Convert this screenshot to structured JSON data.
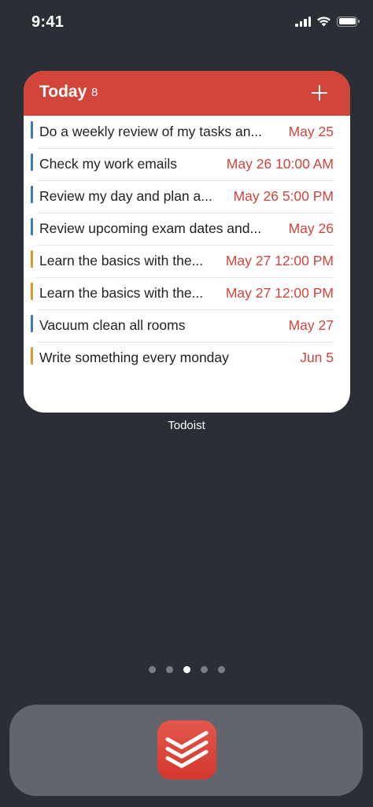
{
  "status_bar": {
    "time": "9:41",
    "signal_icon": "cellular-signal-icon",
    "wifi_icon": "wifi-icon",
    "battery_icon": "battery-icon"
  },
  "widget": {
    "title": "Today",
    "count": "8",
    "add_icon": "plus-icon",
    "accent_color": "#d1453b",
    "tasks": [
      {
        "title": "Do a weekly review of my tasks an...",
        "date": "May 25",
        "color": "#3d7ac9"
      },
      {
        "title": "Check my work emails",
        "date": "May 26 10:00 AM",
        "color": "#3d7ac9"
      },
      {
        "title": "Review my day and plan a...",
        "date": "May 26 5:00 PM",
        "color": "#3d7ac9"
      },
      {
        "title": "Review upcoming exam dates and...",
        "date": "May 26",
        "color": "#3d7ac9"
      },
      {
        "title": "Learn the basics with the...",
        "date": "May 27 12:00 PM",
        "color": "#e0982d"
      },
      {
        "title": "Learn the basics with the...",
        "date": "May 27 12:00 PM",
        "color": "#e0982d"
      },
      {
        "title": "Vacuum clean all rooms",
        "date": "May 27",
        "color": "#3d7ac9"
      },
      {
        "title": "Write something every monday",
        "date": "Jun 5",
        "color": "#e0982d"
      }
    ]
  },
  "widget_label": "Todoist",
  "page_indicator": {
    "pages": 5,
    "current": 3
  },
  "dock": {
    "apps": [
      {
        "icon": "todoist-app-icon"
      }
    ]
  }
}
